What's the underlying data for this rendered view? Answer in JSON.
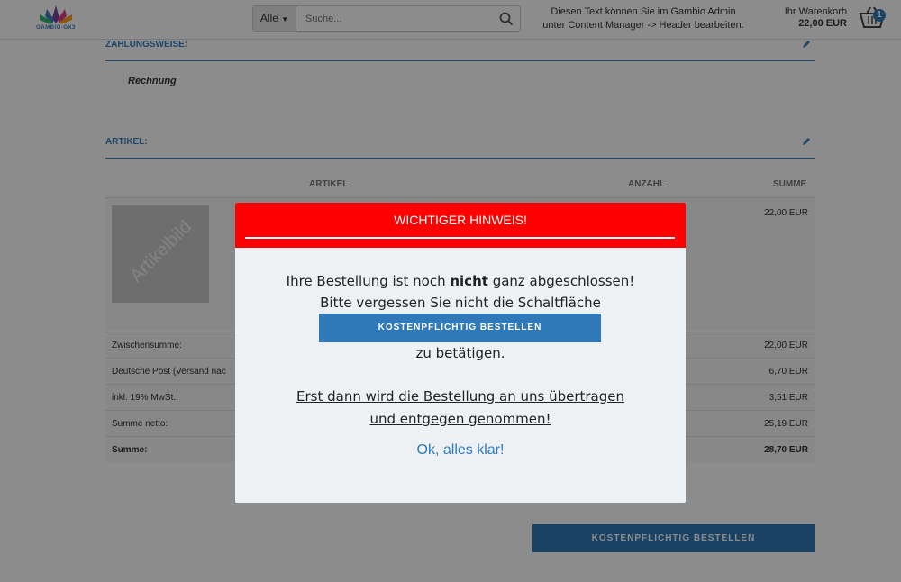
{
  "header": {
    "logo_text": "GAMBIO-GX3",
    "search_category": "Alle",
    "search_placeholder": "Suche...",
    "notice_line1": "Diesen Text können Sie im Gambio Admin",
    "notice_line2": "unter Content Manager -> Header bearbeiten.",
    "cart_label": "Ihr Warenkorb",
    "cart_total": "22,00 EUR",
    "cart_count": "1"
  },
  "payment": {
    "title": "ZAHLUNGSWEISE:",
    "value": "Rechnung"
  },
  "articles": {
    "title": "ARTIKEL:",
    "columns": [
      "ARTIKEL",
      "ANZAHL",
      "SUMME"
    ],
    "item_image_text": "Artikelbild",
    "item_price": "22,00 EUR"
  },
  "totals": [
    {
      "label": "Zwischensumme:",
      "value": "22,00 EUR"
    },
    {
      "label": "Deutsche Post (Versand nac",
      "value": "6,70 EUR"
    },
    {
      "label": "inkl. 19% MwSt.:",
      "value": "3,51 EUR"
    },
    {
      "label": "Summe netto:",
      "value": "25,19 EUR"
    },
    {
      "label": "Summe:",
      "value": "28,70 EUR"
    }
  ],
  "order_button": "KOSTENPFLICHTIG BESTELLEN",
  "modal": {
    "title": "WICHTIGER HINWEIS!",
    "line1_pre": "Ihre Bestellung ist noch ",
    "line1_bold": "nicht",
    "line1_post": " ganz abgeschlossen!",
    "line2": "Bitte vergessen Sie nicht die Schaltfläche",
    "button": "KOSTENPFLICHTIG BESTELLEN",
    "line3": "zu betätigen.",
    "line4": "Erst dann wird die Bestellung an uns übertragen",
    "line5": "und entgegen genommen!",
    "ok": "Ok, alles klar!"
  },
  "colors": {
    "accent": "#2f79b9",
    "modal_header": "#ff0000"
  }
}
